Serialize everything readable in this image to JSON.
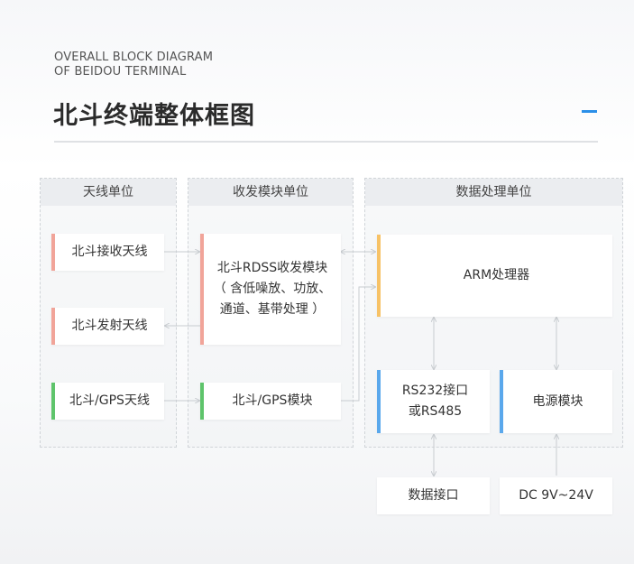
{
  "header": {
    "subtitle_line1": "OVERALL BLOCK DIAGRAM",
    "subtitle_line2": "OF BEIDOU TERMINAL",
    "title": "北斗终端整体框图"
  },
  "panels": {
    "antenna": {
      "title": "天线单位"
    },
    "transceiver": {
      "title": "收发模块单位"
    },
    "processing": {
      "title": "数据处理单位"
    }
  },
  "blocks": {
    "rx_antenna": "北斗接收天线",
    "tx_antenna": "北斗发射天线",
    "gps_antenna": "北斗/GPS天线",
    "rdss_line1": "北斗RDSS收发模块",
    "rdss_line2": "（ 含低噪放、功放、",
    "rdss_line3": "通道、基带处理 ）",
    "gps_module": "北斗/GPS模块",
    "arm": "ARM处理器",
    "rs_line1": "RS232接口",
    "rs_line2": "或RS485",
    "power": "电源模块",
    "data_interface": "数据接口",
    "dc": "DC 9V~24V"
  },
  "colors": {
    "accent": "#2b8fe8",
    "bar_red": "#f1a499",
    "bar_green": "#5ec46b",
    "bar_orange": "#f7c266",
    "bar_blue": "#5aa8ec"
  }
}
